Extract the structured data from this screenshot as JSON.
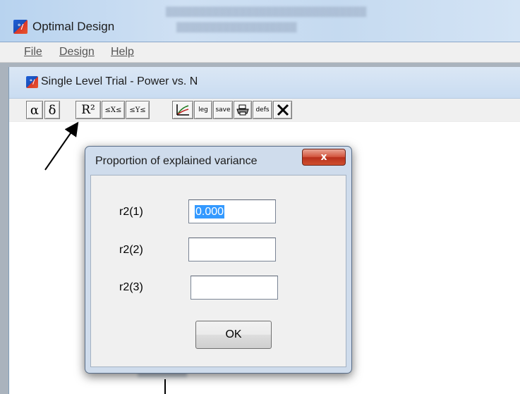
{
  "main_window": {
    "title": "Optimal Design",
    "icon": "optimal-design-app-icon",
    "menu": [
      {
        "label": "File"
      },
      {
        "label": "Design"
      },
      {
        "label": "Help"
      }
    ]
  },
  "child_window": {
    "title": "Single Level Trial - Power vs. N",
    "icon": "optimal-design-app-icon",
    "toolbar": [
      {
        "id": "alpha",
        "label": "α"
      },
      {
        "id": "delta",
        "label": "δ"
      },
      {
        "id": "r2",
        "label": "R²"
      },
      {
        "id": "x-range",
        "label": "≤X≤"
      },
      {
        "id": "y-range",
        "label": "≤Y≤"
      },
      {
        "id": "graph",
        "icon": "graph-icon"
      },
      {
        "id": "legend",
        "label": "leg"
      },
      {
        "id": "save",
        "label": "save"
      },
      {
        "id": "print",
        "icon": "printer-icon"
      },
      {
        "id": "defs",
        "label": "defs"
      },
      {
        "id": "close",
        "icon": "close-x-icon"
      }
    ]
  },
  "dialog": {
    "title": "Proportion of explained variance",
    "close_label": "x",
    "fields": [
      {
        "label": "r2(1)",
        "value": "0.000"
      },
      {
        "label": "r2(2)",
        "value": ""
      },
      {
        "label": "r2(3)",
        "value": ""
      }
    ],
    "ok_label": "OK"
  },
  "colors": {
    "titlebar": "#c5daf0",
    "close_button": "#d3553e",
    "selection": "#3399ff"
  }
}
